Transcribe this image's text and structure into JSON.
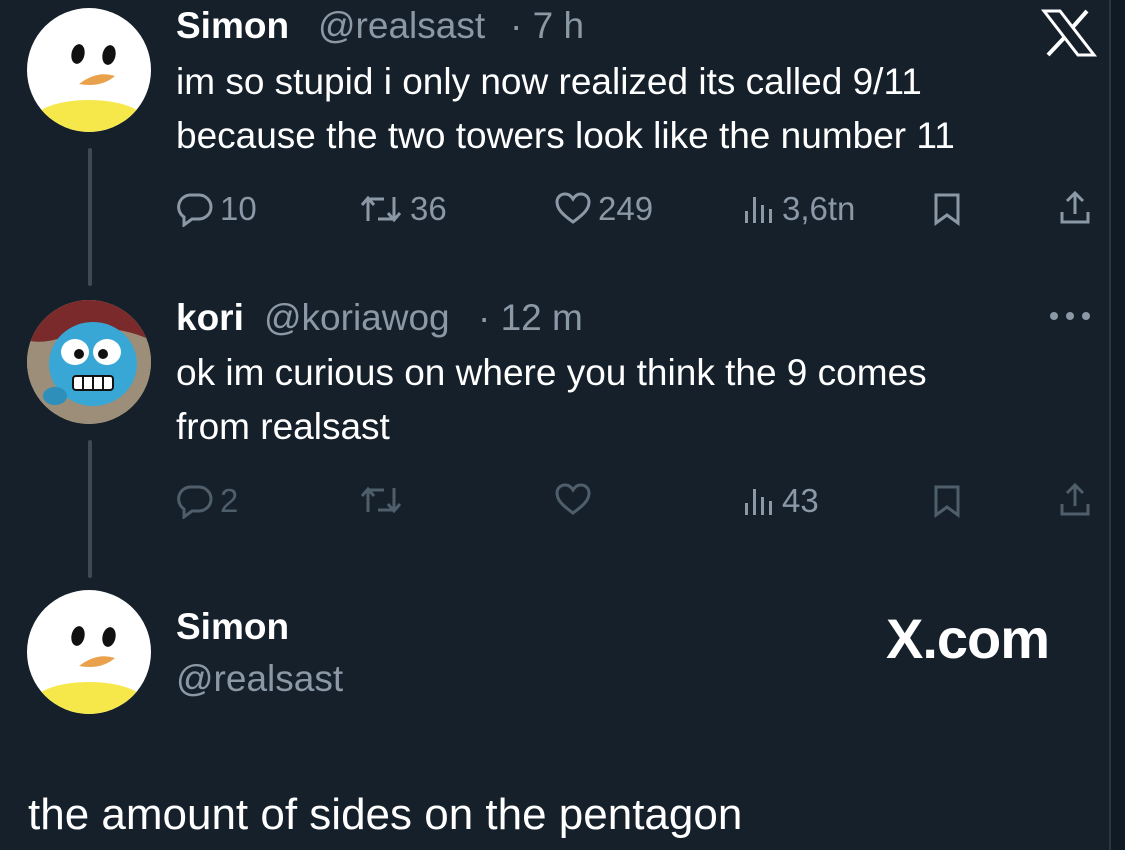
{
  "tweet1": {
    "name": "Simon",
    "handle": "@realsast",
    "time": "· 7 h",
    "text_line1": "im so stupid i only now realized its called 9/11",
    "text_line2": "because the two towers look like the number 11",
    "replies": "10",
    "retweets": "36",
    "likes": "249",
    "views": "3,6tn"
  },
  "tweet2": {
    "name": "kori",
    "handle": "@koriawog",
    "time": "· 12 m",
    "text_line1": "ok im curious on where you think the 9 comes",
    "text_line2": "from realsast",
    "replies": "2",
    "views": "43"
  },
  "card": {
    "name": "Simon",
    "handle": "@realsast",
    "brand": "X.com",
    "text": "the amount of sides on the pentagon"
  },
  "icons": {
    "x_logo": "x-logo-icon",
    "more": "more-icon",
    "reply": "reply-icon",
    "retweet": "retweet-icon",
    "like": "heart-icon",
    "views": "views-icon",
    "bookmark": "bookmark-icon",
    "share": "share-icon"
  },
  "colors": {
    "background": "#15202b",
    "text": "#ffffff",
    "muted": "#8b98a5",
    "avatar_yellow": "#f6e84b"
  }
}
